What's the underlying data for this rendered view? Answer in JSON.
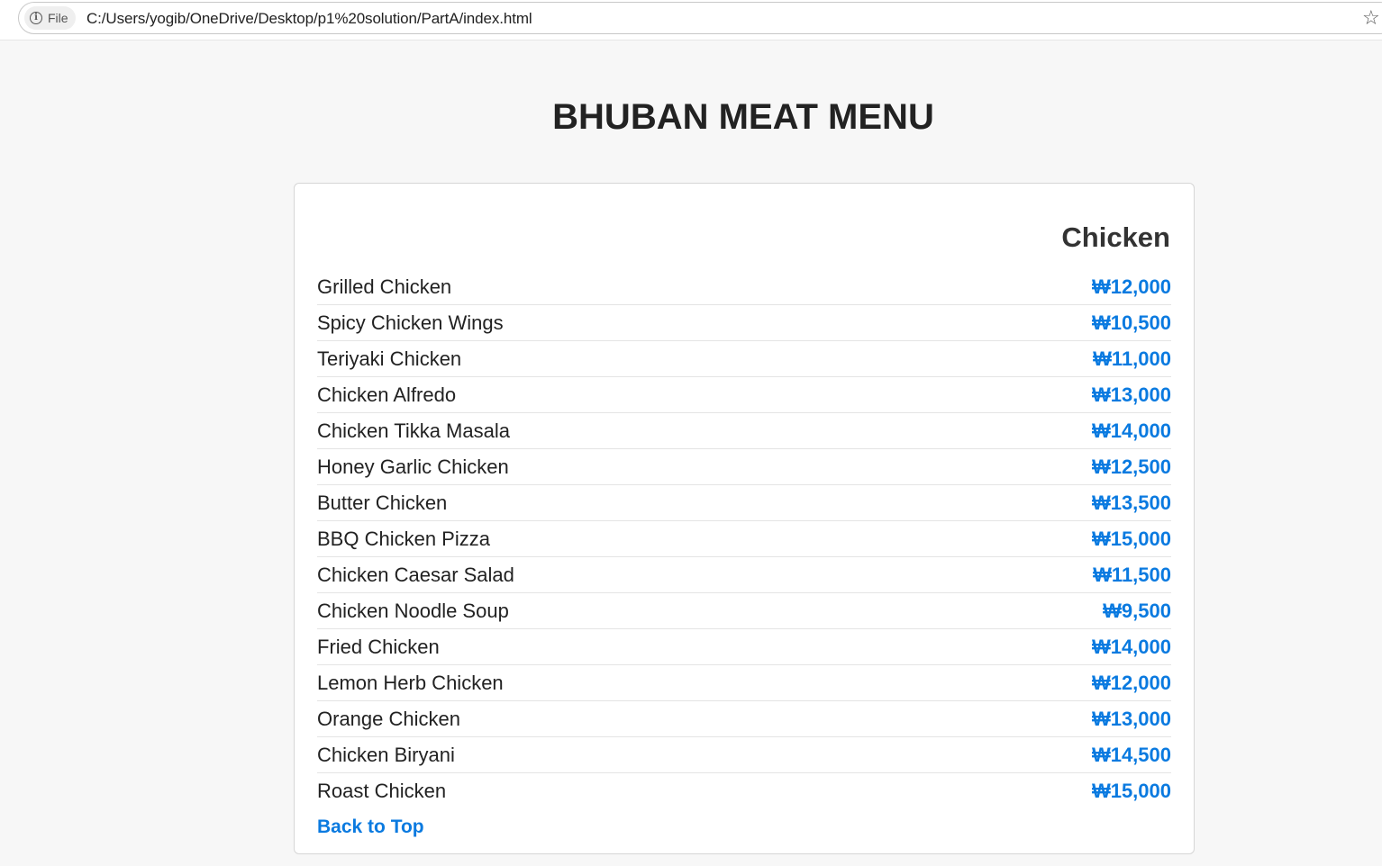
{
  "browser": {
    "site_info_label": "File",
    "url": "C:/Users/yogib/OneDrive/Desktop/p1%20solution/PartA/index.html",
    "star_icon": "bookmark-star-icon"
  },
  "page": {
    "title": "BHUBAN MEAT MENU"
  },
  "section": {
    "title": "Chicken",
    "items": [
      {
        "name": "Grilled Chicken",
        "price": "₩12,000"
      },
      {
        "name": "Spicy Chicken Wings",
        "price": "₩10,500"
      },
      {
        "name": "Teriyaki Chicken",
        "price": "₩11,000"
      },
      {
        "name": "Chicken Alfredo",
        "price": "₩13,000"
      },
      {
        "name": "Chicken Tikka Masala",
        "price": "₩14,000"
      },
      {
        "name": "Honey Garlic Chicken",
        "price": "₩12,500"
      },
      {
        "name": "Butter Chicken",
        "price": "₩13,500"
      },
      {
        "name": "BBQ Chicken Pizza",
        "price": "₩15,000"
      },
      {
        "name": "Chicken Caesar Salad",
        "price": "₩11,500"
      },
      {
        "name": "Chicken Noodle Soup",
        "price": "₩9,500"
      },
      {
        "name": "Fried Chicken",
        "price": "₩14,000"
      },
      {
        "name": "Lemon Herb Chicken",
        "price": "₩12,000"
      },
      {
        "name": "Orange Chicken",
        "price": "₩13,000"
      },
      {
        "name": "Chicken Biryani",
        "price": "₩14,500"
      },
      {
        "name": "Roast Chicken",
        "price": "₩15,000"
      }
    ],
    "back_link": "Back to Top"
  },
  "colors": {
    "accent": "#0a7ae0",
    "background": "#f7f7f7"
  }
}
